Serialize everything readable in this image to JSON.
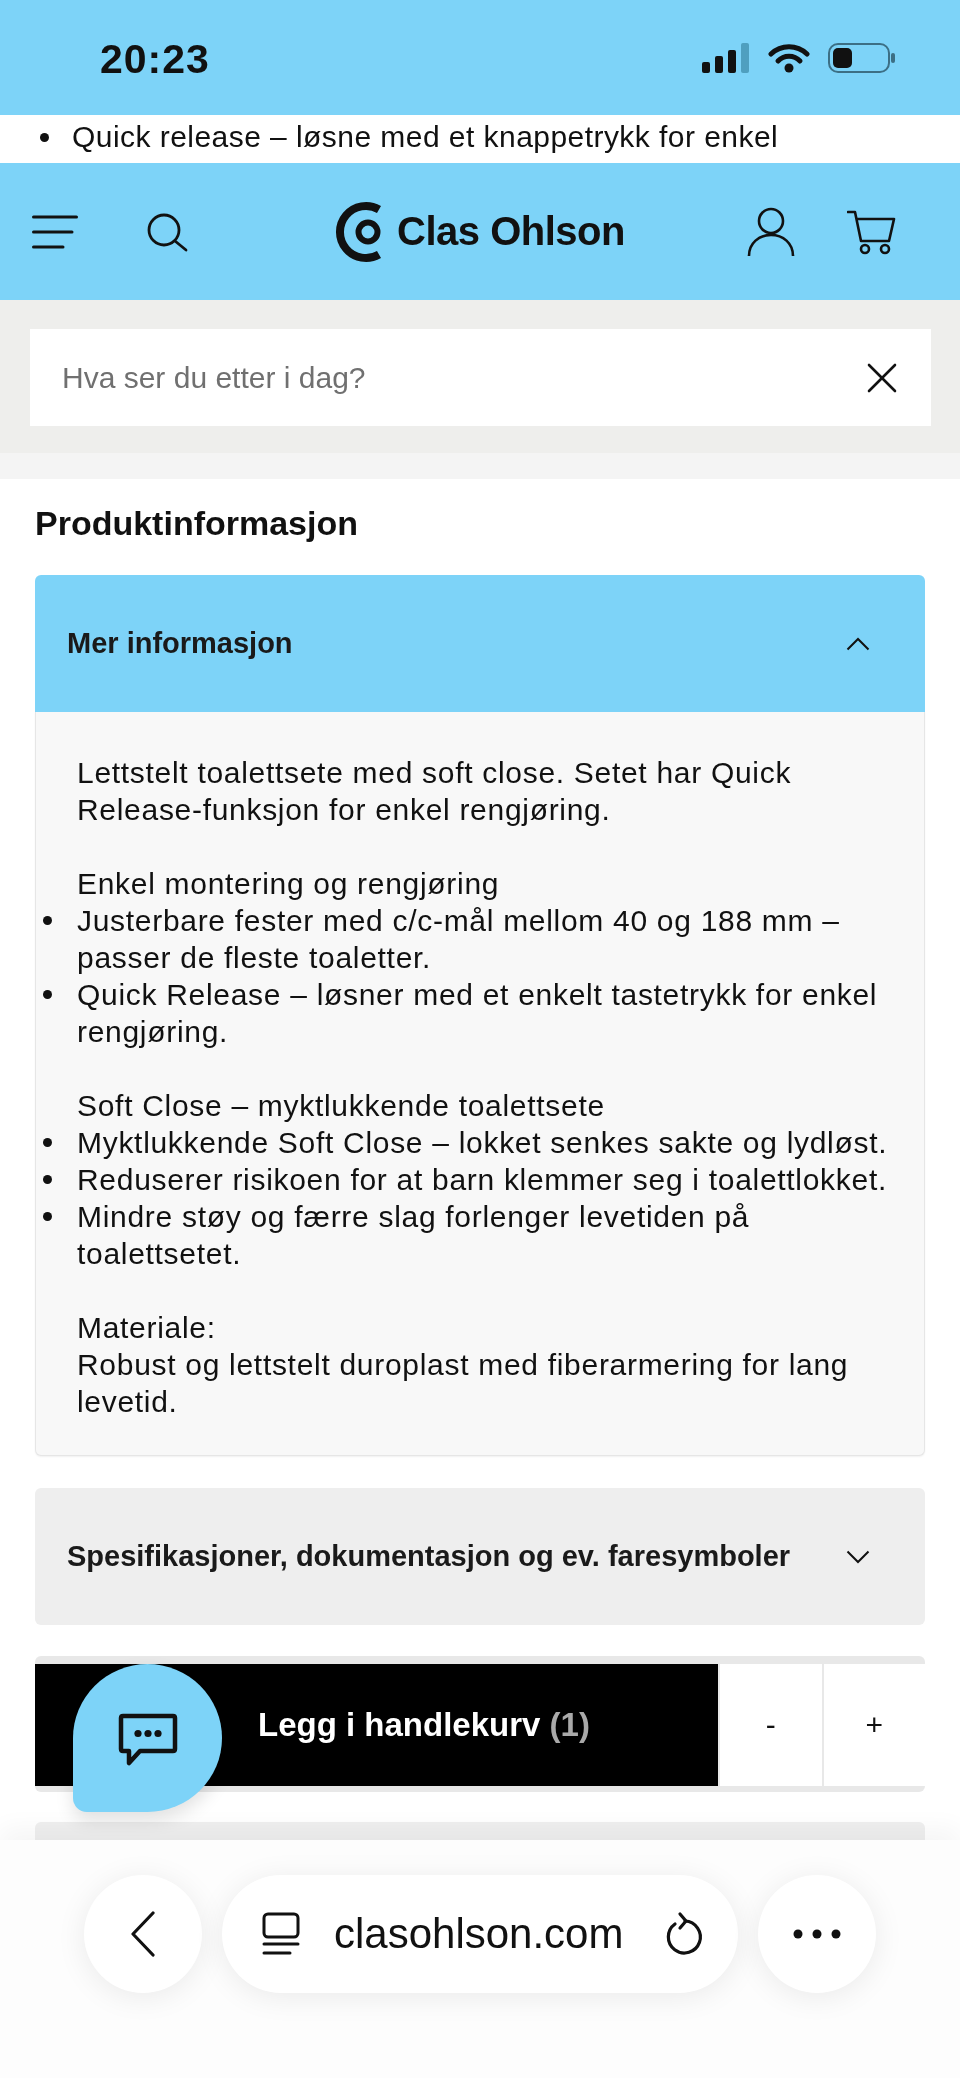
{
  "status_bar": {
    "time": "20:23"
  },
  "scrolled_list": [
    "Quick release – løsne med et knappetrykk for enkel"
  ],
  "header": {
    "logo": "Clas Ohlson"
  },
  "search": {
    "placeholder": "Hva ser du etter i dag?"
  },
  "section_title": "Produktinformasjon",
  "accordions": [
    {
      "title": "Mer informasjon",
      "expanded": true,
      "content": [
        [
          {
            "kind": "text",
            "text": "Lettstelt toalettsete med soft close. Setet har Quick Release-funksjon for enkel rengjøring."
          }
        ],
        [
          {
            "kind": "text",
            "text": "Enkel montering og rengjøring"
          },
          {
            "kind": "bullet",
            "text": "Justerbare fester med c/c-mål mellom 40 og 188 mm – passer de fleste toaletter."
          },
          {
            "kind": "bullet",
            "text": "Quick Release – løsner med et enkelt tastetrykk for enkel rengjøring."
          }
        ],
        [
          {
            "kind": "text",
            "text": "Soft Close – myktlukkende toalettsete"
          },
          {
            "kind": "bullet",
            "text": "Myktlukkende Soft Close – lokket senkes sakte og lydløst."
          },
          {
            "kind": "bullet",
            "text": "Reduserer risikoen for at barn klemmer seg i toalettlokket."
          },
          {
            "kind": "bullet",
            "text": "Mindre støy og færre slag forlenger levetiden på toalettsetet."
          }
        ],
        [
          {
            "kind": "text",
            "text": "Materiale:"
          },
          {
            "kind": "text",
            "text": "Robust og lettstelt duroplast med fiberarmering for lang levetid."
          }
        ]
      ]
    },
    {
      "title": "Spesifikasjoner, dokumentasjon og ev. faresymboler",
      "expanded": false
    }
  ],
  "cart_bar": {
    "label": "Legg i handlekurv",
    "count": "(1)",
    "decrease": "-",
    "increase": "+"
  },
  "browser": {
    "url": "clasohlson.com"
  }
}
